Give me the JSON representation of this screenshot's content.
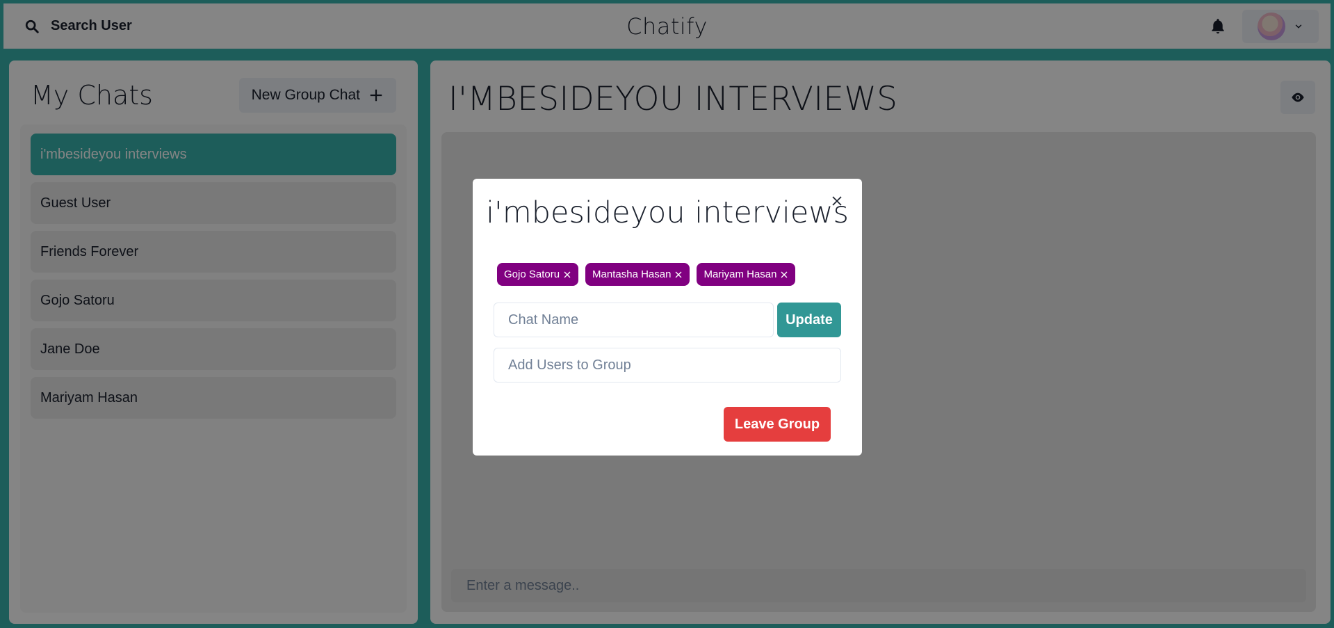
{
  "header": {
    "search_label": "Search User",
    "app_title": "Chatify",
    "search_icon": "search-icon",
    "bell_icon": "bell-icon",
    "chevron_icon": "chevron-down-icon"
  },
  "sidebar": {
    "title": "My Chats",
    "new_group_label": "New Group Chat",
    "chats": [
      {
        "name": "i'mbesideyou interviews",
        "active": true
      },
      {
        "name": "Guest User",
        "active": false
      },
      {
        "name": "Friends Forever",
        "active": false
      },
      {
        "name": "Gojo Satoru",
        "active": false
      },
      {
        "name": "Jane Doe",
        "active": false
      },
      {
        "name": "Mariyam Hasan",
        "active": false
      }
    ]
  },
  "chat": {
    "title": "I'MBESIDEYOU INTERVIEWS",
    "message_placeholder": "Enter a message.."
  },
  "modal": {
    "title": "i'mbesideyou interviews",
    "members": [
      "Gojo Satoru",
      "Mantasha Hasan",
      "Mariyam Hasan"
    ],
    "chat_name_placeholder": "Chat Name",
    "update_label": "Update",
    "add_users_placeholder": "Add Users to Group",
    "leave_label": "Leave Group"
  },
  "colors": {
    "teal": "#38B2AC",
    "update_button": "#319795",
    "badge_purple": "#800080",
    "leave_red": "#E53E3E"
  }
}
